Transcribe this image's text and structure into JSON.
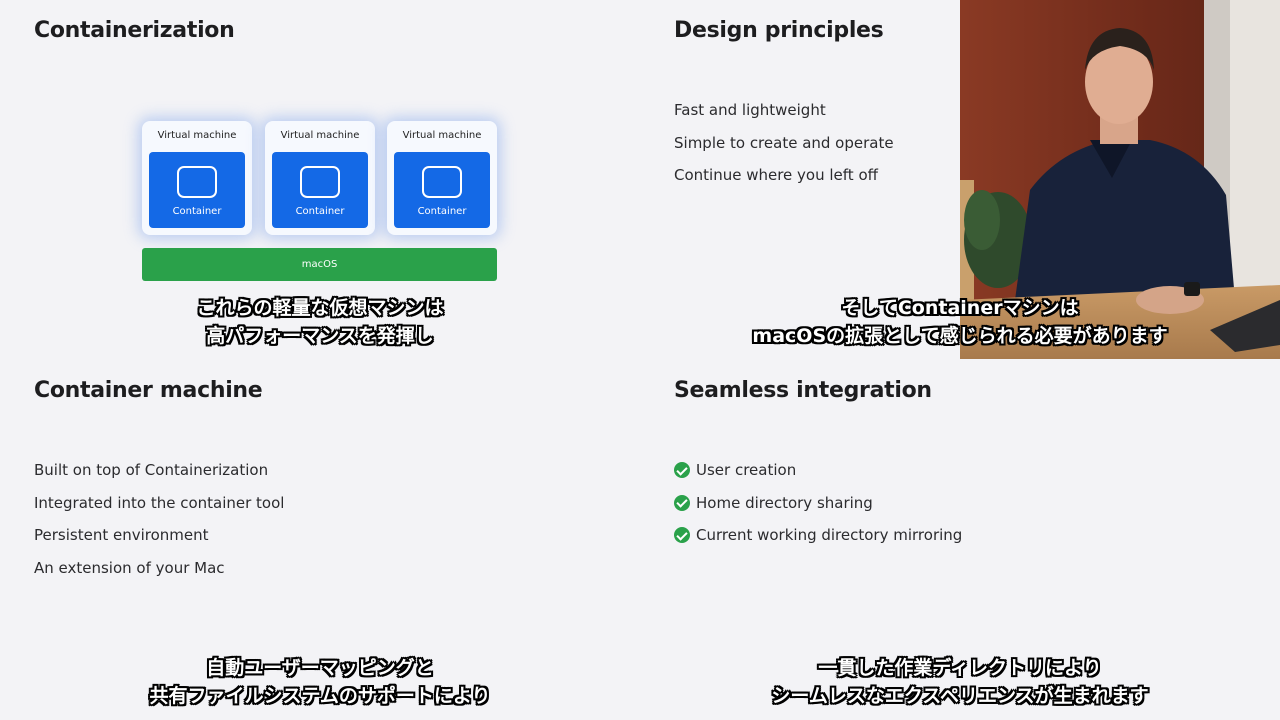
{
  "quadrants": {
    "containerization": {
      "title": "Containerization",
      "diagram": {
        "vm_label": "Virtual machine",
        "container_label": "Container",
        "host_label": "macOS"
      },
      "subtitle": [
        "これらの軽量な仮想マシンは",
        "高パフォーマンスを発揮し"
      ]
    },
    "design_principles": {
      "title": "Design principles",
      "items": [
        "Fast and lightweight",
        "Simple to create and operate",
        "Continue where you left off"
      ],
      "subtitle": [
        "そしてContainerマシンは",
        "macOSの拡張として感じられる必要があります"
      ]
    },
    "container_machine": {
      "title": "Container machine",
      "items": [
        "Built on top of Containerization",
        "Integrated into the container tool",
        "Persistent environment",
        "An extension of your Mac"
      ],
      "subtitle": [
        "自動ユーザーマッピングと",
        "共有ファイルシステムのサポートにより"
      ]
    },
    "seamless_integration": {
      "title": "Seamless integration",
      "items": [
        "User creation",
        "Home directory sharing",
        "Current working directory mirroring"
      ],
      "subtitle": [
        "一貫した作業ディレクトリにより",
        "シームレスなエクスペリエンスが生まれます"
      ]
    }
  },
  "colors": {
    "background": "#f3f3f6",
    "container_blue": "#1469e6",
    "macos_green": "#2aa14a",
    "check_green": "#2aa14a"
  },
  "icons": {
    "check": "checkmark-circle-icon",
    "container": "window-outline-icon"
  }
}
